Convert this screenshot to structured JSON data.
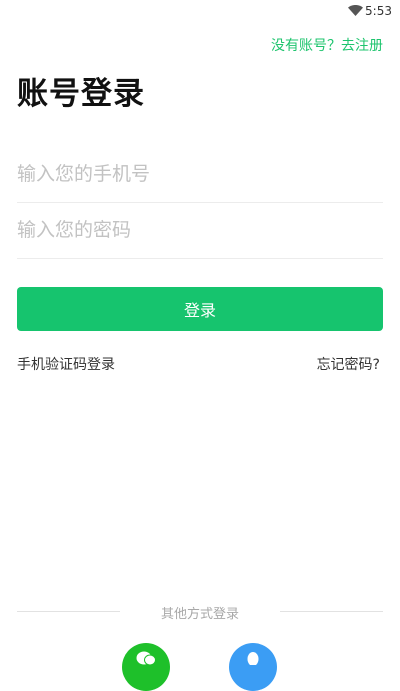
{
  "status_bar": {
    "time": "5:53",
    "wifi_icon": "wifi-icon"
  },
  "header": {
    "register_link": "没有账号？去注册",
    "title": "账号登录"
  },
  "form": {
    "phone_placeholder": "输入您的手机号",
    "phone_value": "",
    "password_placeholder": "输入您的密码",
    "password_value": "",
    "login_button": "登录"
  },
  "links": {
    "sms_login": "手机验证码登录",
    "forgot_password": "忘记密码?"
  },
  "other_login": {
    "label": "其他方式登录",
    "methods": [
      {
        "icon": "wechat-icon",
        "color": "#1ec02a"
      },
      {
        "icon": "qq-icon",
        "color": "#3b9df4"
      }
    ]
  },
  "colors": {
    "accent": "#16c46e",
    "link": "#1ec46e",
    "placeholder": "#c2c2c2"
  }
}
